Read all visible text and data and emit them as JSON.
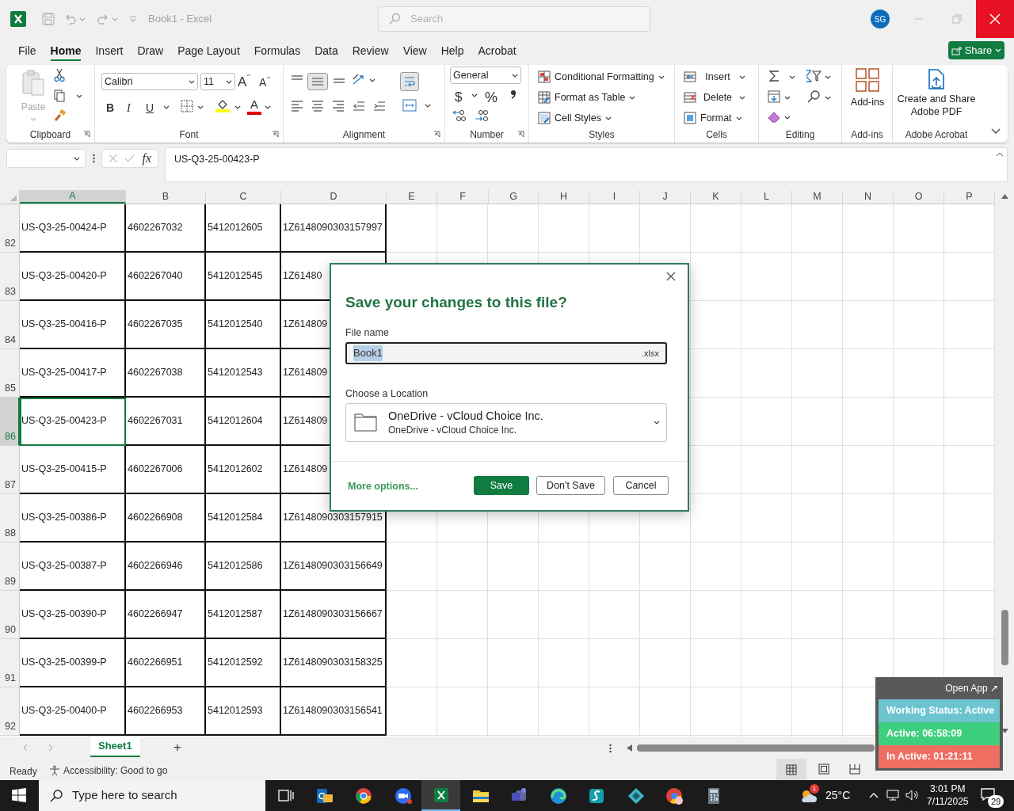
{
  "title_bar": {
    "title": "Book1 - Excel",
    "search_placeholder": "Search",
    "avatar": "SG"
  },
  "menu_tabs": [
    {
      "label": "File",
      "selected": false
    },
    {
      "label": "Home",
      "selected": true
    },
    {
      "label": "Insert",
      "selected": false
    },
    {
      "label": "Draw",
      "selected": false
    },
    {
      "label": "Page Layout",
      "selected": false
    },
    {
      "label": "Formulas",
      "selected": false
    },
    {
      "label": "Data",
      "selected": false
    },
    {
      "label": "Review",
      "selected": false
    },
    {
      "label": "View",
      "selected": false
    },
    {
      "label": "Help",
      "selected": false
    },
    {
      "label": "Acrobat",
      "selected": false
    }
  ],
  "share_button": "Share",
  "ribbon": {
    "paste": "Paste",
    "clipboard_label": "Clipboard",
    "font_name": "Calibri",
    "font_size": "11",
    "grow_font": "A",
    "shrink_font": "A",
    "bold": "B",
    "italic": "I",
    "underline": "U",
    "font_color": "A",
    "font_label": "Font",
    "alignment_label": "Alignment",
    "number_format": "General",
    "currency": "$",
    "percent": "%",
    "number_label": "Number",
    "styles": [
      "Conditional Formatting",
      "Format as Table",
      "Cell Styles"
    ],
    "styles_label": "Styles",
    "cells": [
      "Insert",
      "Delete",
      "Format"
    ],
    "cells_label": "Cells",
    "editing_label": "Editing",
    "addins_button": "Add-ins",
    "addins_label": "Add-ins",
    "acrobat_button": "Create and Share Adobe PDF",
    "acrobat_label": "Adobe Acrobat"
  },
  "formula_bar": {
    "fx": "fx",
    "value": "US-Q3-25-00423-P"
  },
  "columns": [
    {
      "label": "A",
      "selected": true
    },
    {
      "label": "B",
      "selected": false
    },
    {
      "label": "C",
      "selected": false
    },
    {
      "label": "D",
      "selected": false
    },
    {
      "label": "E",
      "selected": false
    },
    {
      "label": "F",
      "selected": false
    },
    {
      "label": "G",
      "selected": false
    },
    {
      "label": "H",
      "selected": false
    },
    {
      "label": "I",
      "selected": false
    },
    {
      "label": "J",
      "selected": false
    },
    {
      "label": "K",
      "selected": false
    },
    {
      "label": "L",
      "selected": false
    },
    {
      "label": "M",
      "selected": false
    },
    {
      "label": "N",
      "selected": false
    },
    {
      "label": "O",
      "selected": false
    },
    {
      "label": "P",
      "selected": false
    }
  ],
  "rows": [
    {
      "number": "82",
      "selected": false,
      "cells": [
        "US-Q3-25-00424-P",
        "4602267032",
        "5412012605",
        "1Z6148090303157997"
      ]
    },
    {
      "number": "83",
      "selected": false,
      "cells": [
        "US-Q3-25-00420-P",
        "4602267040",
        "5412012545",
        "1Z61480"
      ]
    },
    {
      "number": "84",
      "selected": false,
      "cells": [
        "US-Q3-25-00416-P",
        "4602267035",
        "5412012540",
        "1Z614809"
      ]
    },
    {
      "number": "85",
      "selected": false,
      "cells": [
        "US-Q3-25-00417-P",
        "4602267038",
        "5412012543",
        "1Z614809"
      ]
    },
    {
      "number": "86",
      "selected": true,
      "cells": [
        "US-Q3-25-00423-P",
        "4602267031",
        "5412012604",
        "1Z614809"
      ]
    },
    {
      "number": "87",
      "selected": false,
      "cells": [
        "US-Q3-25-00415-P",
        "4602267006",
        "5412012602",
        "1Z614809"
      ]
    },
    {
      "number": "88",
      "selected": false,
      "cells": [
        "US-Q3-25-00386-P",
        "4602266908",
        "5412012584",
        "1Z6148090303157915"
      ]
    },
    {
      "number": "89",
      "selected": false,
      "cells": [
        "US-Q3-25-00387-P",
        "4602266946",
        "5412012586",
        "1Z6148090303156649"
      ]
    },
    {
      "number": "90",
      "selected": false,
      "cells": [
        "US-Q3-25-00390-P",
        "4602266947",
        "5412012587",
        "1Z6148090303156667"
      ]
    },
    {
      "number": "91",
      "selected": false,
      "cells": [
        "US-Q3-25-00399-P",
        "4602266951",
        "5412012592",
        "1Z6148090303158325"
      ]
    },
    {
      "number": "92",
      "selected": false,
      "cells": [
        "US-Q3-25-00400-P",
        "4602266953",
        "5412012593",
        "1Z6148090303156541"
      ]
    }
  ],
  "sheet_tabs": [
    {
      "label": "Sheet1",
      "selected": true
    }
  ],
  "new_sheet": "+",
  "status_bar": {
    "ready": "Ready",
    "accessibility": "Accessibility: Good to go"
  },
  "dialog": {
    "title": "Save your changes to this file?",
    "file_name_label": "File name",
    "file_name": "Book1",
    "extension": ".xlsx",
    "location_label": "Choose a Location",
    "location_title": "OneDrive - vCloud Choice Inc.",
    "location_subtitle": "OneDrive - vCloud Choice Inc.",
    "more_options": "More options...",
    "buttons": [
      "Save",
      "Don't Save",
      "Cancel"
    ]
  },
  "tracker": {
    "open_app": "Open App ↗",
    "statuses": [
      {
        "text": "Working Status: Active",
        "color": "#6cc4cf"
      },
      {
        "text": "Active: 06:58:09",
        "color": "#3ecf7e"
      },
      {
        "text": "In Active: 01:21:11",
        "color": "#ee6e62"
      }
    ]
  },
  "taskbar": {
    "search_placeholder": "Type here to search",
    "apps": [
      {
        "selected": false
      },
      {
        "selected": false
      },
      {
        "selected": false
      },
      {
        "selected": false
      },
      {
        "selected": true
      },
      {
        "selected": false
      },
      {
        "selected": false
      },
      {
        "selected": false
      },
      {
        "selected": false
      },
      {
        "selected": false
      },
      {
        "selected": false
      },
      {
        "selected": false
      }
    ],
    "weather_badge": "1",
    "temperature": "25°C",
    "time": "3:01 PM",
    "date": "7/11/2025",
    "notifications": "29"
  }
}
